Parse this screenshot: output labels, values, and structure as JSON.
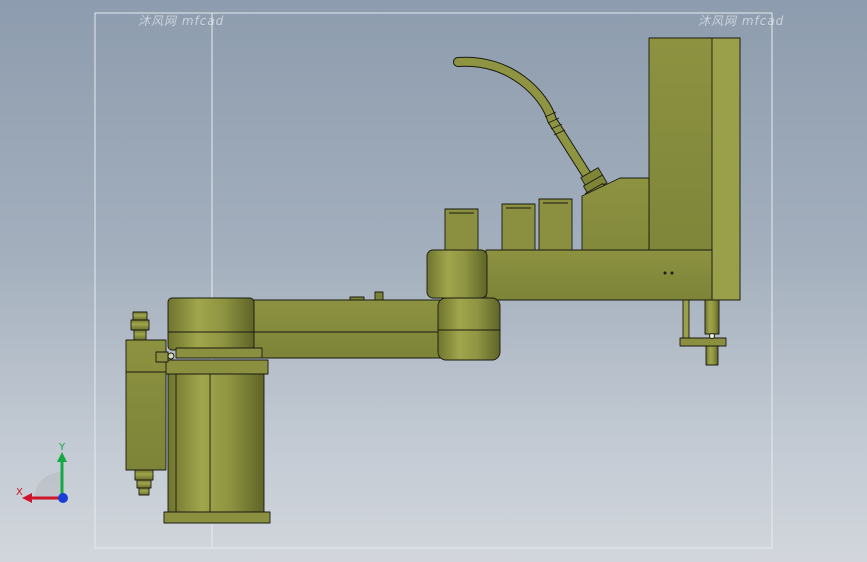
{
  "watermark": {
    "left_text": "沐风网 mfcad",
    "right_text": "沐风网 mfcad"
  },
  "triad": {
    "x_label": "X",
    "y_label": "Y",
    "x_color": "#d0152a",
    "y_color": "#16a845",
    "z_color": "#1b3fd6"
  },
  "colors": {
    "body": "#8a8f3c",
    "body_light": "#9ba24a",
    "body_dark": "#6f742e",
    "outline": "#1a1a10",
    "background_top": "#8d9cae",
    "background_bottom": "#d2d6dc",
    "frame_line": "#e6eaef"
  }
}
